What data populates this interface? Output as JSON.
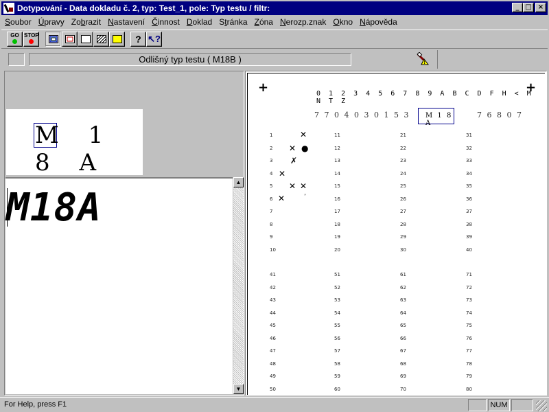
{
  "window": {
    "title": "Dotypování - Data dokladu č. 2,  typ: Test_1,  pole: Typ testu / filtr:",
    "buttons": {
      "minimize": "_",
      "maximize": "□",
      "close": "×"
    }
  },
  "menu": {
    "items": [
      "Soubor",
      "Úpravy",
      "Zobrazit",
      "Nastavení",
      "Činnost",
      "Doklad",
      "Stránka",
      "Zóna",
      "Nerozp.znak",
      "Okno",
      "Nápověda"
    ],
    "underlined": [
      "S",
      "Ú",
      "b",
      "N",
      "Č",
      "D",
      "t",
      "Z",
      "N",
      "O",
      "N"
    ]
  },
  "toolbar": {
    "go_label": "GO",
    "stop_label": "STOP",
    "colors": {
      "go_dot": "#00c000",
      "stop_dot": "#ff0000"
    },
    "icons": [
      "go-icon",
      "stop-icon",
      "zone-view-icon",
      "zone-frame-icon",
      "blank-doc-icon",
      "hatch-icon",
      "yellow-box-icon",
      "help-icon",
      "context-help-icon"
    ]
  },
  "status_strip": {
    "message": "Odlišný typ testu ( M18B )"
  },
  "left": {
    "image_text": "M 1 8 A",
    "entry_value": "M18A"
  },
  "form": {
    "charset": "0 1 2 3 4 5 6 7 8 9 A B C D F H < M N T Z",
    "hw_left": "7 7 0 4 0 3 0 1 5 3",
    "field": "M 1 8 A",
    "hw_right": "7 6 8 0 7",
    "numbers": [
      [
        "1",
        "11",
        "21",
        "31"
      ],
      [
        "2",
        "12",
        "22",
        "32"
      ],
      [
        "3",
        "13",
        "23",
        "33"
      ],
      [
        "4",
        "14",
        "24",
        "34"
      ],
      [
        "5",
        "15",
        "25",
        "35"
      ],
      [
        "6",
        "16",
        "26",
        "36"
      ],
      [
        "7",
        "17",
        "27",
        "37"
      ],
      [
        "8",
        "18",
        "28",
        "38"
      ],
      [
        "9",
        "19",
        "29",
        "39"
      ],
      [
        "10",
        "20",
        "30",
        "40"
      ],
      [
        "41",
        "51",
        "61",
        "71"
      ],
      [
        "42",
        "52",
        "62",
        "72"
      ],
      [
        "43",
        "53",
        "63",
        "73"
      ],
      [
        "44",
        "54",
        "64",
        "74"
      ],
      [
        "45",
        "55",
        "65",
        "75"
      ],
      [
        "46",
        "56",
        "66",
        "76"
      ],
      [
        "47",
        "57",
        "67",
        "77"
      ],
      [
        "48",
        "58",
        "68",
        "78"
      ],
      [
        "49",
        "59",
        "69",
        "79"
      ],
      [
        "50",
        "60",
        "70",
        "80"
      ]
    ]
  },
  "statusbar": {
    "help": "For Help, press F1",
    "num": "NUM"
  }
}
